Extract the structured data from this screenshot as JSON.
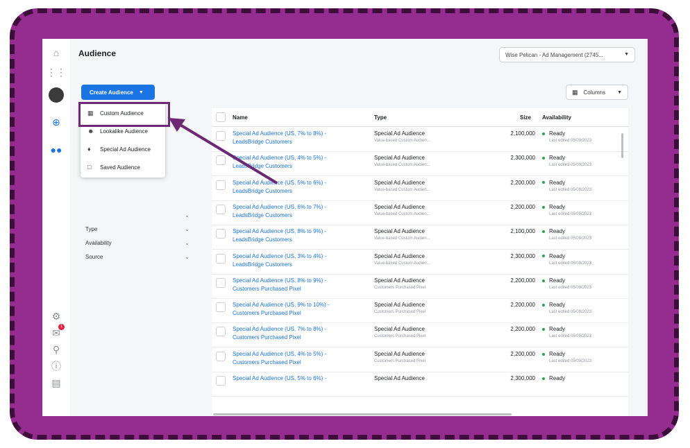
{
  "header": {
    "title": "Audience",
    "account": "Wise Pelican - Ad Management (2745..."
  },
  "toolbar": {
    "create_label": "Create Audience",
    "columns_label": "Columns"
  },
  "menu": {
    "items": [
      {
        "label": "Custom Audience",
        "icon": "custom-audience-icon"
      },
      {
        "label": "Lookalike Audience",
        "icon": "lookalike-icon"
      },
      {
        "label": "Special Ad Audience",
        "icon": "special-ad-icon"
      },
      {
        "label": "Saved Audience",
        "icon": "folder-icon"
      }
    ]
  },
  "filters": {
    "type": "Type",
    "availability": "Availability",
    "source": "Source"
  },
  "table": {
    "headers": {
      "name": "Name",
      "type": "Type",
      "size": "Size",
      "availability": "Availability"
    },
    "rows": [
      {
        "name": "Special Ad Audience (US, 7% to 8%) - LeadsBridge Customers",
        "type": "Special Ad Audience",
        "sub": "Value-based Custom Audien...",
        "size": "2,100,000",
        "status": "Ready",
        "edited": "Last edited 05/09/2023"
      },
      {
        "name": "Special Ad Audience (US, 4% to 5%) - LeadsBridge Customers",
        "type": "Special Ad Audience",
        "sub": "Value-based Custom Audien...",
        "size": "2,300,000",
        "status": "Ready",
        "edited": "Last edited 05/09/2023"
      },
      {
        "name": "Special Ad Audience (US, 5% to 6%) - LeadsBridge Customers",
        "type": "Special Ad Audience",
        "sub": "Value-based Custom Audien...",
        "size": "2,200,000",
        "status": "Ready",
        "edited": "Last edited 05/09/2023"
      },
      {
        "name": "Special Ad Audience (US, 6% to 7%) - LeadsBridge Customers",
        "type": "Special Ad Audience",
        "sub": "Value-based Custom Audien...",
        "size": "2,200,000",
        "status": "Ready",
        "edited": "Last edited 05/09/2023"
      },
      {
        "name": "Special Ad Audience (US, 8% to 9%) - LeadsBridge Customers",
        "type": "Special Ad Audience",
        "sub": "Value-based Custom Audien...",
        "size": "2,100,000",
        "status": "Ready",
        "edited": "Last edited 05/09/2023"
      },
      {
        "name": "Special Ad Audience (US, 3% to 4%) - LeadsBridge Customers",
        "type": "Special Ad Audience",
        "sub": "Value-based Custom Audien...",
        "size": "2,300,000",
        "status": "Ready",
        "edited": "Last edited 05/09/2023"
      },
      {
        "name": "Special Ad Audience (US, 8% to 9%) - Customers Purchased Pixel",
        "type": "Special Ad Audience",
        "sub": "Customers Purchased Pixel",
        "size": "2,200,000",
        "status": "Ready",
        "edited": "Last edited 05/09/2023"
      },
      {
        "name": "Special Ad Audience (US, 9% to 10%) - Customers Purchased Pixel",
        "type": "Special Ad Audience",
        "sub": "Customers Purchased Pixel",
        "size": "2,200,000",
        "status": "Ready",
        "edited": "Last edited 05/09/2023"
      },
      {
        "name": "Special Ad Audience (US, 7% to 8%) - Customers Purchased Pixel",
        "type": "Special Ad Audience",
        "sub": "Customers Purchased Pixel",
        "size": "2,200,000",
        "status": "Ready",
        "edited": "Last edited 05/09/2023"
      },
      {
        "name": "Special Ad Audience (US, 4% to 5%) - Customers Purchased Pixel",
        "type": "Special Ad Audience",
        "sub": "Customers Purchased Pixel",
        "size": "2,200,000",
        "status": "Ready",
        "edited": "Last edited 05/09/2023"
      },
      {
        "name": "Special Ad Audience (US, 5% to 6%) -",
        "type": "Special Ad Audience",
        "sub": "",
        "size": "2,300,000",
        "status": "Ready",
        "edited": ""
      }
    ]
  },
  "colors": {
    "frame": "#952c8f",
    "frame_border": "#3f0d3c",
    "accent": "#1b74e4",
    "ready": "#31a24c",
    "highlight": "#6c2a74"
  }
}
